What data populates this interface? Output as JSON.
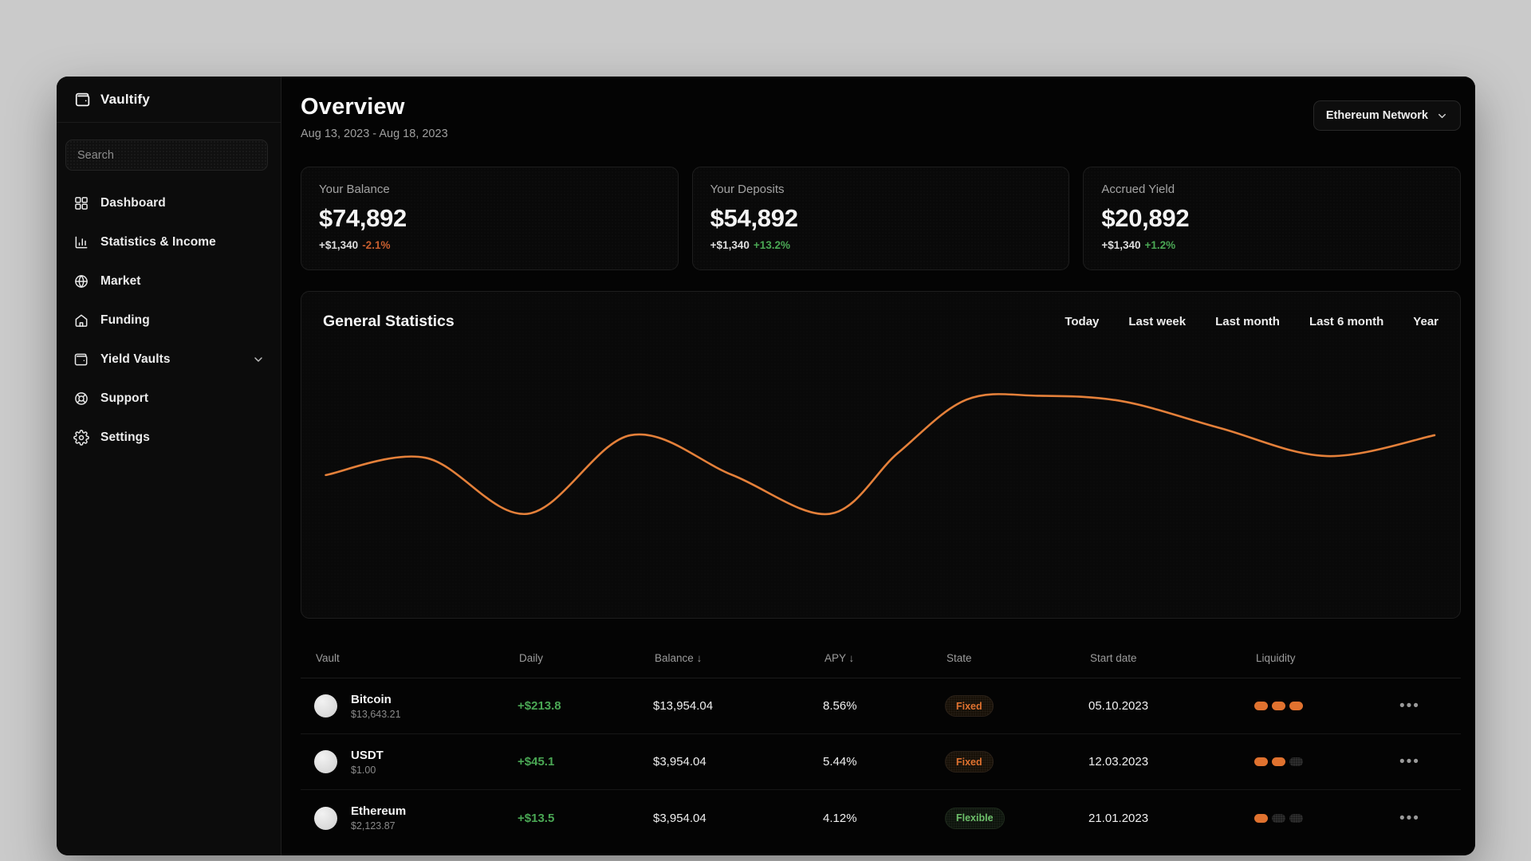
{
  "app": {
    "name": "Vaultify",
    "colors": {
      "background_gray": "#cacaca",
      "surface_black": "#040404",
      "accent_orange": "#e0722f",
      "positive_green": "#4aa754",
      "negative_orange": "#c75e2e"
    }
  },
  "sidebar": {
    "logo": {
      "label": "Vaultify",
      "icon": "wallet-icon"
    },
    "search": {
      "placeholder": "Search"
    },
    "items": [
      {
        "label": "Dashboard",
        "icon": "dashboard-grid-icon",
        "has_chevron": false
      },
      {
        "label": "Statistics & Income",
        "icon": "bar-chart-icon",
        "has_chevron": false
      },
      {
        "label": "Market",
        "icon": "globe-icon",
        "has_chevron": false
      },
      {
        "label": "Funding",
        "icon": "home-icon",
        "has_chevron": false
      },
      {
        "label": "Yield Vaults",
        "icon": "wallet-icon",
        "has_chevron": true
      },
      {
        "label": "Support",
        "icon": "lifebuoy-icon",
        "has_chevron": false
      },
      {
        "label": "Settings",
        "icon": "gear-icon",
        "has_chevron": false
      }
    ]
  },
  "header": {
    "title": "Overview",
    "date_range": "Aug 13, 2023 - Aug 18, 2023",
    "network_selector": {
      "label": "Ethereum Network",
      "icon": "chevron-down-icon"
    }
  },
  "stat_cards": [
    {
      "label": "Your Balance",
      "value": "$74,892",
      "delta": "+$1,340",
      "percent": "-2.1%",
      "direction": "down"
    },
    {
      "label": "Your Deposits",
      "value": "$54,892",
      "delta": "+$1,340",
      "percent": "+13.2%",
      "direction": "up"
    },
    {
      "label": "Accrued Yield",
      "value": "$20,892",
      "delta": "+$1,340",
      "percent": "+1.2%",
      "direction": "up"
    }
  ],
  "statistics_panel": {
    "title": "General Statistics",
    "filters": [
      "Today",
      "Last week",
      "Last month",
      "Last 6 month",
      "Year"
    ]
  },
  "chart_data": {
    "type": "line",
    "title": "General Statistics",
    "legend": [],
    "axes_visible": false,
    "grid": false,
    "line_color": "#e4803a",
    "note": "No axes, ticks or labels are shown; points are relative positions in the plot area (x 0-100 left to right, y 0-100 bottom to top).",
    "points": [
      {
        "x": 2.1,
        "y": 43.8
      },
      {
        "x": 10.7,
        "y": 49.1
      },
      {
        "x": 19.5,
        "y": 31.9
      },
      {
        "x": 28.4,
        "y": 56.0
      },
      {
        "x": 37.2,
        "y": 43.8
      },
      {
        "x": 45.6,
        "y": 31.9
      },
      {
        "x": 51.5,
        "y": 50.6
      },
      {
        "x": 57.4,
        "y": 66.9
      },
      {
        "x": 63.7,
        "y": 68.1
      },
      {
        "x": 70.9,
        "y": 66.4
      },
      {
        "x": 79.3,
        "y": 58.2
      },
      {
        "x": 88.5,
        "y": 49.6
      },
      {
        "x": 97.8,
        "y": 56.0
      }
    ]
  },
  "table": {
    "columns": [
      {
        "label": "Vault",
        "sort_arrow": ""
      },
      {
        "label": "Daily",
        "sort_arrow": ""
      },
      {
        "label": "Balance",
        "sort_arrow": "↓"
      },
      {
        "label": "APY",
        "sort_arrow": "↓"
      },
      {
        "label": "State",
        "sort_arrow": ""
      },
      {
        "label": "Start date",
        "sort_arrow": ""
      },
      {
        "label": "Liquidity",
        "sort_arrow": ""
      }
    ],
    "rows": [
      {
        "vault": "Bitcoin",
        "price": "$13,643.21",
        "daily": "+$213.8",
        "balance": "$13,954.04",
        "apy": "8.56%",
        "state": "Fixed",
        "state_type": "fixed",
        "start_date": "05.10.2023",
        "liquidity_level": 3,
        "liquidity_max": 3
      },
      {
        "vault": "USDT",
        "price": "$1.00",
        "daily": "+$45.1",
        "balance": "$3,954.04",
        "apy": "5.44%",
        "state": "Fixed",
        "state_type": "fixed",
        "start_date": "12.03.2023",
        "liquidity_level": 2,
        "liquidity_max": 3
      },
      {
        "vault": "Ethereum",
        "price": "$2,123.87",
        "daily": "+$13.5",
        "balance": "$3,954.04",
        "apy": "4.12%",
        "state": "Flexible",
        "state_type": "flexible",
        "start_date": "21.01.2023",
        "liquidity_level": 1,
        "liquidity_max": 3
      }
    ],
    "row_menu_icon": "ellipsis-icon"
  }
}
